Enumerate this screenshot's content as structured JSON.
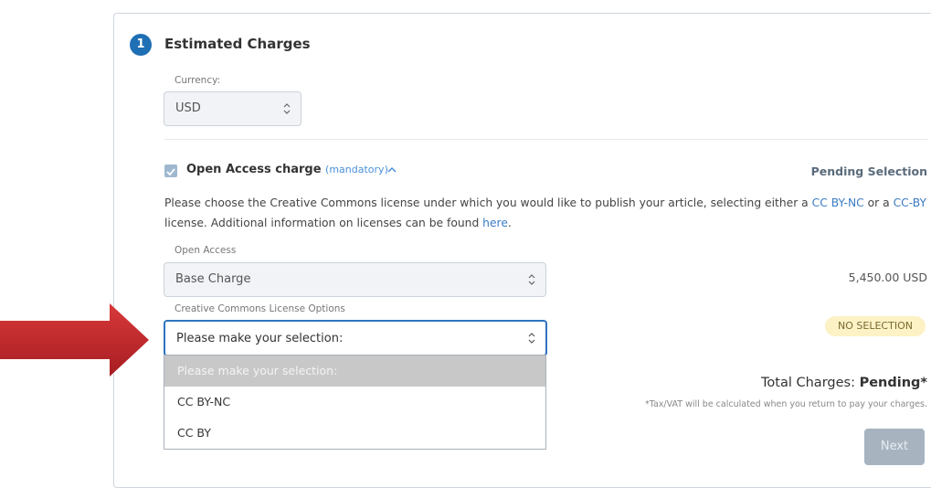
{
  "section": {
    "step": "1",
    "title": "Estimated Charges"
  },
  "currency": {
    "label": "Currency:",
    "value": "USD"
  },
  "open_access": {
    "title": "Open Access charge",
    "mandatory": "(mandatory)",
    "status": "Pending Selection",
    "description_prefix": "Please choose the Creative Commons license under which you would like to publish your article, selecting either a ",
    "link_ccbync": "CC BY-NC",
    "description_mid1": " or a ",
    "link_ccby": "CC-BY",
    "description_mid2": " license. Additional information on licenses can be found ",
    "link_here": "here",
    "description_suffix": "."
  },
  "base_charge": {
    "label": "Open Access",
    "value": "Base Charge",
    "price": "5,450.00 USD"
  },
  "license": {
    "label": "Creative Commons License Options",
    "value": "Please make your selection:",
    "badge": "NO SELECTION",
    "options": [
      "Please make your selection:",
      "CC BY-NC",
      "CC BY"
    ]
  },
  "totals": {
    "label": "Total Charges:",
    "value": "Pending*",
    "tax_note": "*Tax/VAT will be calculated when you return to pay your charges."
  },
  "next_button": "Next",
  "colors": {
    "accent": "#1f6fb5",
    "link": "#3b7cc4",
    "arrow": "#c0272d",
    "badge_bg": "#fdf2c6"
  },
  "icons": {
    "dropdown": "chevron-up-down-icon",
    "collapse": "caret-up-icon",
    "pointer": "arrow-right-icon"
  }
}
